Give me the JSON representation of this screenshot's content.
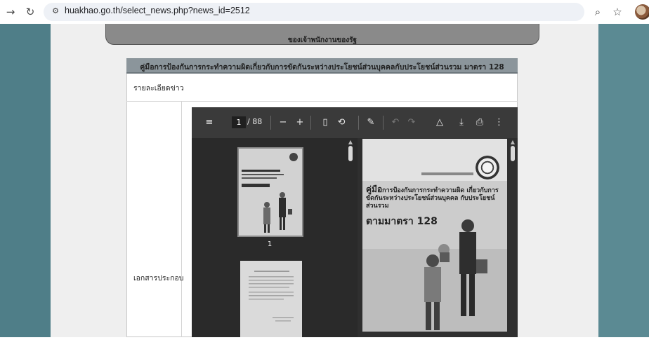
{
  "browser": {
    "url": "huakhao.go.th/select_news.php?news_id=2512",
    "icons": [
      "back-icon",
      "reload-icon",
      "site-info-icon",
      "zoom-icon",
      "star-icon"
    ]
  },
  "page": {
    "box_title": "คู่มือการป้องกันการกระทำความผิดเกี่ยวกับการขัดกันระหว่างประโยชน์ส่วนบุคคลกับประโยชน์ส่วนรวม มาตรา 128",
    "banner_line2": "ของเจ้าพนักงานของรัฐ",
    "label_detail": "รายละเอียดข่าว",
    "label_attachment": "เอกสารประกอบ"
  },
  "pdf_viewer": {
    "current_page": "1",
    "total_pages": "/ 88",
    "thumb_label": "1",
    "cover": {
      "title_lead": "คู่มือ",
      "title_rest": "การป้องกันการกระทำความผิด เกี่ยวกับการขัดกันระหว่างประโยชน์ส่วนบุคคล กับประโยชน์ส่วนรวม",
      "big_title": "ตามมาตรา 128"
    }
  },
  "colors": {
    "page_bg": "#5b8a93",
    "content_bg": "#efefef",
    "box_header": "#8b959b",
    "pdf_bg": "#2f2f2f"
  }
}
